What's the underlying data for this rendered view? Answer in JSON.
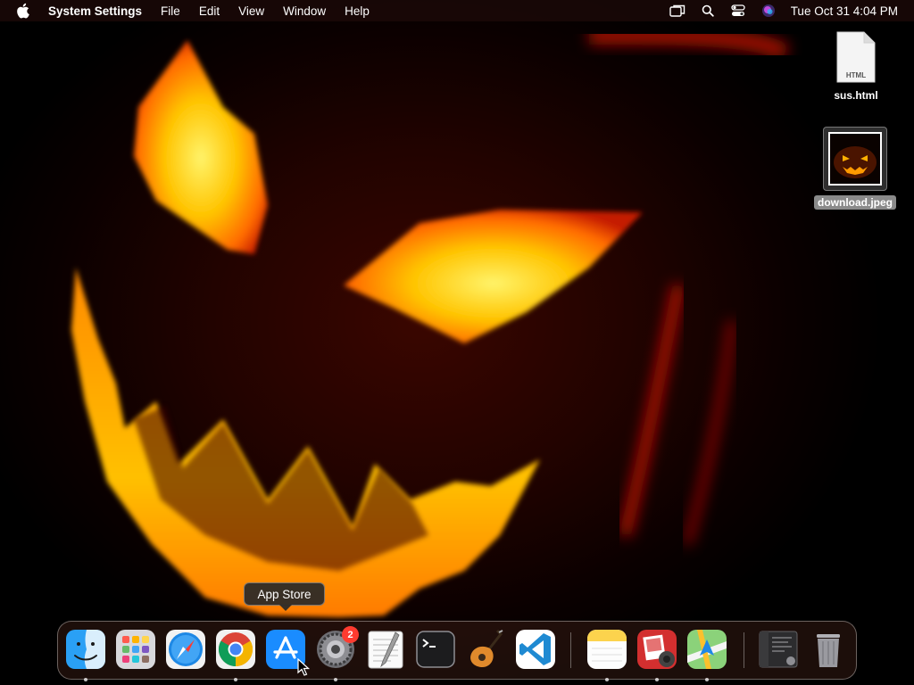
{
  "menubar": {
    "app_name": "System Settings",
    "menus": [
      "File",
      "Edit",
      "View",
      "Window",
      "Help"
    ],
    "clock": "Tue Oct 31  4:04 PM"
  },
  "desktop": {
    "files": [
      {
        "name": "sus.html",
        "type_label": "HTML"
      },
      {
        "name": "download.jpeg",
        "selected": true
      }
    ]
  },
  "tooltip": {
    "text": "App Store"
  },
  "dock": {
    "apps": [
      {
        "name": "Finder",
        "running": true
      },
      {
        "name": "Launchpad",
        "running": false
      },
      {
        "name": "Safari",
        "running": false
      },
      {
        "name": "Google Chrome",
        "running": true
      },
      {
        "name": "App Store",
        "running": false
      },
      {
        "name": "System Settings",
        "running": true,
        "badge": "2"
      },
      {
        "name": "TextEdit",
        "running": false
      },
      {
        "name": "Terminal",
        "running": false
      },
      {
        "name": "GarageBand",
        "running": false
      },
      {
        "name": "Visual Studio Code",
        "running": false
      },
      {
        "name": "Notes",
        "running": true
      },
      {
        "name": "Photo Booth",
        "running": true
      },
      {
        "name": "Maps",
        "running": true
      },
      {
        "name": "Recent Document",
        "running": false
      },
      {
        "name": "Trash",
        "running": false
      }
    ]
  },
  "colors": {
    "accent_badge": "#ff3b30",
    "wallpaper_glow": "#ffb000",
    "wallpaper_base": "#220300"
  }
}
